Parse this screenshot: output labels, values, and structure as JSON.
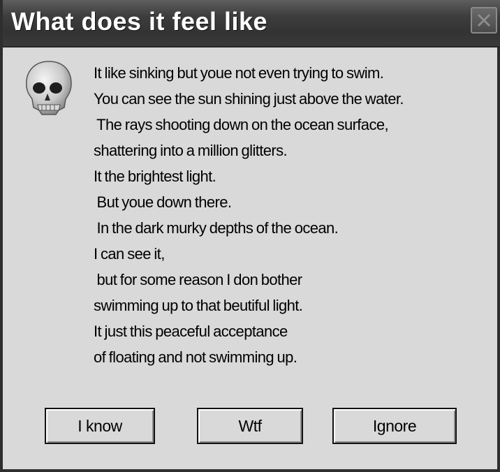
{
  "dialog": {
    "title": "What does it feel like",
    "icon": "skull-icon",
    "message_lines": [
      "It like sinking but youe not even trying to swim.",
      "You can see the sun shining just above the water.",
      " The rays shooting down on the ocean surface,",
      "shattering into a million glitters.",
      "It the brightest light.",
      " But youe down there.",
      " In the dark murky depths of the ocean.",
      "I can see it,",
      " but for some reason I don bother",
      "swimming up to that beutiful light.",
      "It just this peaceful acceptance",
      "of floating and not swimming up."
    ],
    "buttons": {
      "know": "I know",
      "wtf": "Wtf",
      "ignore": "Ignore"
    }
  },
  "colors": {
    "titlebar": "#3d3d3d",
    "dialog_bg": "#d9d9d9",
    "title_text": "#ffffff"
  }
}
